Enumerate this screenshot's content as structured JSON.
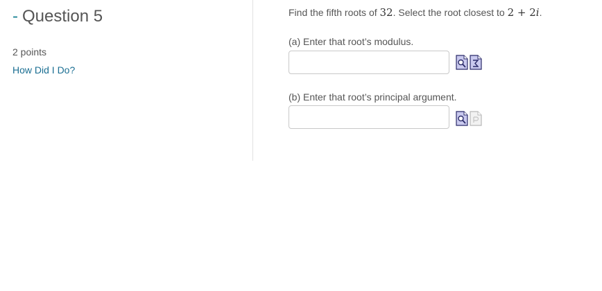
{
  "question": {
    "collapse_symbol": "-",
    "title": "Question 5",
    "points": "2 points",
    "how_did_i_do": "How Did I Do?"
  },
  "prompt": {
    "text_before": "Find the fifth roots of ",
    "number": "32",
    "text_middle": ". Select the root closest to ",
    "target_real": "2",
    "target_plus": " + ",
    "target_imag": "2",
    "target_i": "i",
    "text_end": "."
  },
  "part_a": {
    "label": "(a) Enter that root’s modulus.",
    "value": "",
    "placeholder": "",
    "icons": [
      "preview-icon",
      "equation-editor-icon"
    ]
  },
  "part_b": {
    "label": "(b) Enter that root’s principal argument.",
    "value": "",
    "placeholder": "",
    "icons": [
      "preview-icon",
      "equation-editor-disabled-icon"
    ]
  },
  "colors": {
    "link": "#1a6e92",
    "collapse": "#1e8496",
    "text": "#555555",
    "icon_fill": "#c9c9ee",
    "icon_border": "#2b2b6a"
  }
}
